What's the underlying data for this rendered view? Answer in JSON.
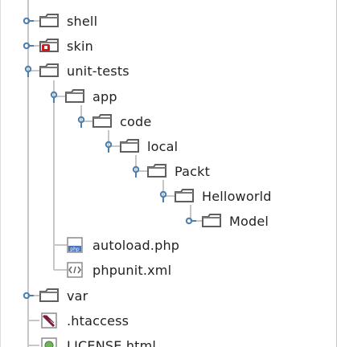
{
  "tree": {
    "items": [
      {
        "label": "shell",
        "icon": "folder-icon",
        "toggle": "collapsed"
      },
      {
        "label": "skin",
        "icon": "folder-locked-icon",
        "toggle": "collapsed"
      },
      {
        "label": "unit-tests",
        "icon": "folder-icon",
        "toggle": "expanded"
      },
      {
        "label": "app",
        "icon": "folder-icon",
        "toggle": "expanded"
      },
      {
        "label": "code",
        "icon": "folder-icon",
        "toggle": "expanded"
      },
      {
        "label": "local",
        "icon": "folder-icon",
        "toggle": "expanded"
      },
      {
        "label": "Packt",
        "icon": "folder-icon",
        "toggle": "expanded"
      },
      {
        "label": "Helloworld",
        "icon": "folder-icon",
        "toggle": "expanded"
      },
      {
        "label": "Model",
        "icon": "folder-icon",
        "toggle": "collapsed"
      },
      {
        "label": "autoload.php",
        "icon": "php-file-icon",
        "toggle": "none"
      },
      {
        "label": "phpunit.xml",
        "icon": "xml-file-icon",
        "toggle": "none"
      },
      {
        "label": "var",
        "icon": "folder-icon",
        "toggle": "collapsed"
      },
      {
        "label": ".htaccess",
        "icon": "htaccess-file-icon",
        "toggle": "none"
      },
      {
        "label": "LICENSE.html",
        "icon": "html-file-icon",
        "toggle": "none"
      }
    ]
  },
  "colors": {
    "tree_line": "#c7c7c7",
    "toggle_blue": "#4a7fb1",
    "folder_outline": "#5f5f5f",
    "folder_tab": "#7a7a7a",
    "text": "#222222"
  }
}
